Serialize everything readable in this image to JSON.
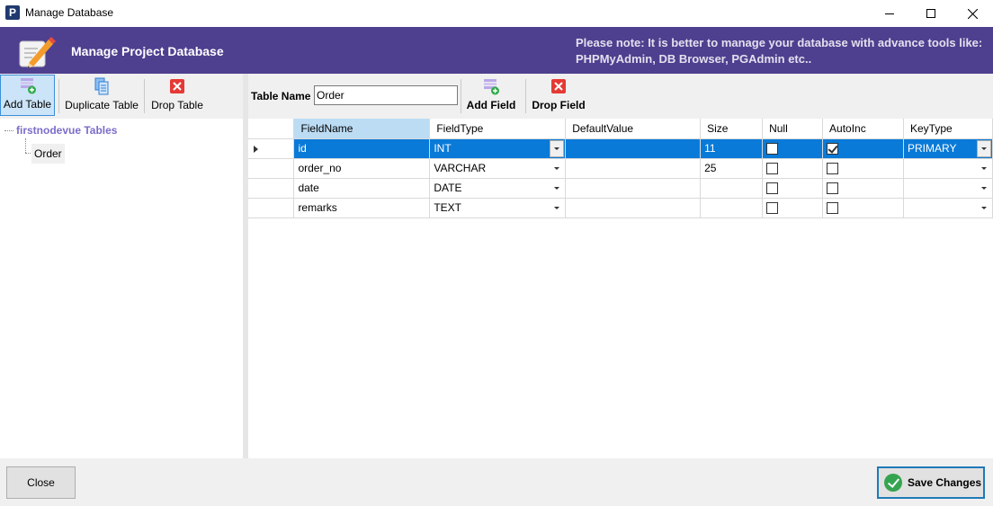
{
  "window": {
    "title": "Manage Database",
    "app_icon_letter": "P"
  },
  "banner": {
    "title": "Manage Project Database",
    "note_line1": "Please note: It is better to manage your database with advance tools like:",
    "note_line2": "PHPMyAdmin, DB Browser, PGAdmin etc.."
  },
  "left_toolbar": {
    "add_table": "Add Table",
    "duplicate_table": "Duplicate Table",
    "drop_table": "Drop Table"
  },
  "tree": {
    "root_label": "firstnodevue Tables",
    "children": [
      "Order"
    ]
  },
  "right_toolbar": {
    "table_name_label": "Table Name",
    "table_name_value": "Order",
    "add_field": "Add Field",
    "drop_field": "Drop Field"
  },
  "grid": {
    "columns": [
      "FieldName",
      "FieldType",
      "DefaultValue",
      "Size",
      "Null",
      "AutoInc",
      "KeyType"
    ],
    "rows": [
      {
        "field_name": "id",
        "field_type": "INT",
        "default_value": "",
        "size": "11",
        "null": false,
        "auto_inc": true,
        "key_type": "PRIMARY"
      },
      {
        "field_name": "order_no",
        "field_type": "VARCHAR",
        "default_value": "",
        "size": "25",
        "null": false,
        "auto_inc": false,
        "key_type": ""
      },
      {
        "field_name": "date",
        "field_type": "DATE",
        "default_value": "",
        "size": "",
        "null": false,
        "auto_inc": false,
        "key_type": ""
      },
      {
        "field_name": "remarks",
        "field_type": "TEXT",
        "default_value": "",
        "size": "",
        "null": false,
        "auto_inc": false,
        "key_type": ""
      }
    ]
  },
  "footer": {
    "close_label": "Close",
    "save_label": "Save Changes"
  },
  "colors": {
    "banner_bg": "#4f3f8f",
    "selection": "#0a7ad8",
    "tree_root": "#7a6dc9",
    "save_border": "#1e7ab8"
  },
  "icons": {
    "app": "app-p-icon",
    "banner": "pencil-note-icon",
    "add_table": "add-table-icon",
    "duplicate_table": "duplicate-icon",
    "drop_table": "red-x-icon",
    "add_field": "add-field-icon",
    "drop_field": "red-x-icon",
    "save": "green-check-icon"
  }
}
